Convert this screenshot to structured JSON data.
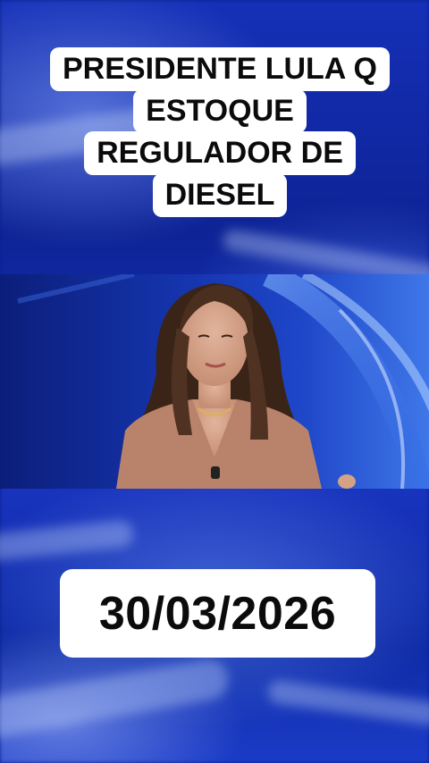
{
  "title_lines": [
    "PRESIDENTE LULA Q",
    "ESTOQUE",
    "REGULADOR DE",
    "DIESEL"
  ],
  "date": "30/03/2026",
  "video": {
    "subject": "news-anchor"
  },
  "colors": {
    "background": "#1630b8",
    "caption_bg": "#ffffff",
    "caption_text": "#0b0b0b"
  }
}
